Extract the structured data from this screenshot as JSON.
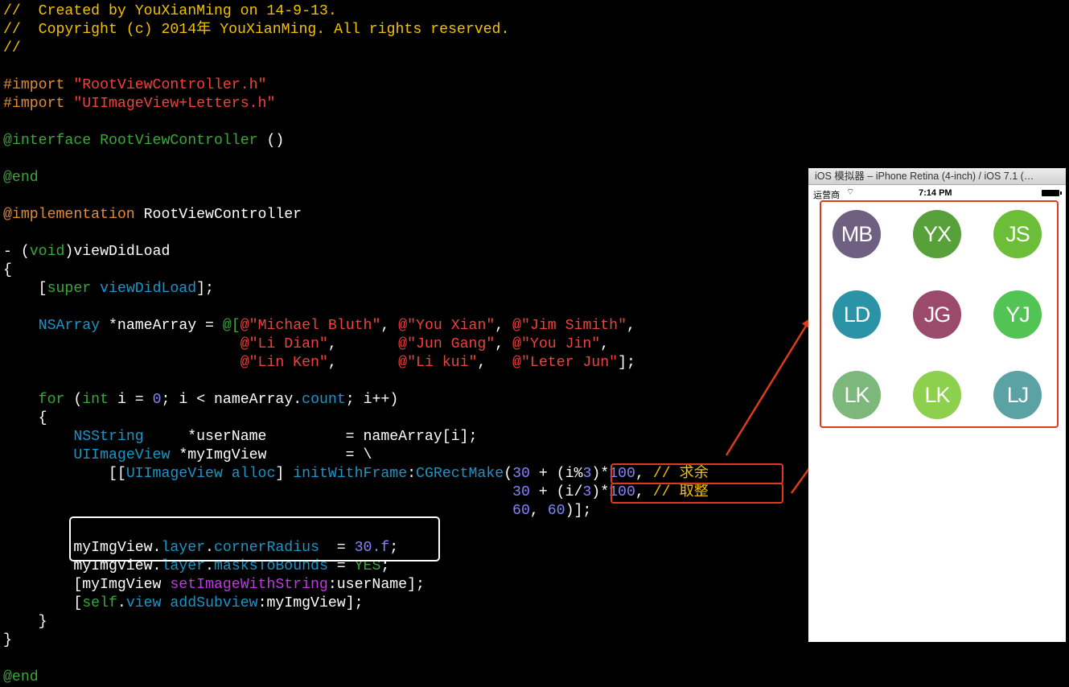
{
  "code_lines": [
    [
      [
        "//  Created by YouXianMing on 14-9-13.",
        "comment"
      ]
    ],
    [
      [
        "//  Copyright (c) 2014年 YouXianMing. All rights reserved.",
        "comment"
      ]
    ],
    [
      [
        "//",
        "comment"
      ]
    ],
    [],
    [
      [
        "#import ",
        "pre"
      ],
      [
        "\"RootViewController.h\"",
        "str"
      ]
    ],
    [
      [
        "#import ",
        "pre"
      ],
      [
        "\"UIImageView+Letters.h\"",
        "str"
      ]
    ],
    [],
    [
      [
        "@interface ",
        "kw"
      ],
      [
        "RootViewController ",
        "kw"
      ],
      [
        "()",
        "plain"
      ]
    ],
    [],
    [
      [
        "@end",
        "kw"
      ]
    ],
    [],
    [
      [
        "@implementation ",
        "pre"
      ],
      [
        "RootViewController",
        "plain"
      ]
    ],
    [],
    [
      [
        "- (",
        "plain"
      ],
      [
        "void",
        "kw"
      ],
      [
        ")viewDidLoad",
        "plain"
      ]
    ],
    [
      [
        "{",
        "plain"
      ]
    ],
    [
      [
        "    [",
        "plain"
      ],
      [
        "super ",
        "kw"
      ],
      [
        "viewDidLoad",
        "type"
      ],
      [
        "];",
        "plain"
      ]
    ],
    [],
    [
      [
        "    ",
        "plain"
      ],
      [
        "NSArray ",
        "type"
      ],
      [
        "*nameArray = ",
        "plain"
      ],
      [
        "@[",
        "kw"
      ],
      [
        "@\"Michael Bluth\"",
        "str"
      ],
      [
        ", ",
        "plain"
      ],
      [
        "@\"You Xian\"",
        "str"
      ],
      [
        ", ",
        "plain"
      ],
      [
        "@\"Jim Simith\"",
        "str"
      ],
      [
        ",",
        "plain"
      ]
    ],
    [
      [
        "                           ",
        "plain"
      ],
      [
        "@\"Li Dian\"",
        "str"
      ],
      [
        ",       ",
        "plain"
      ],
      [
        "@\"Jun Gang\"",
        "str"
      ],
      [
        ", ",
        "plain"
      ],
      [
        "@\"You Jin\"",
        "str"
      ],
      [
        ",",
        "plain"
      ]
    ],
    [
      [
        "                           ",
        "plain"
      ],
      [
        "@\"Lin Ken\"",
        "str"
      ],
      [
        ",       ",
        "plain"
      ],
      [
        "@\"Li kui\"",
        "str"
      ],
      [
        ",   ",
        "plain"
      ],
      [
        "@\"Leter Jun\"",
        "str"
      ],
      [
        "];",
        "plain"
      ]
    ],
    [],
    [
      [
        "    ",
        "plain"
      ],
      [
        "for ",
        "kw"
      ],
      [
        "(",
        "plain"
      ],
      [
        "int ",
        "kw"
      ],
      [
        "i = ",
        "plain"
      ],
      [
        "0",
        "num"
      ],
      [
        "; i < nameArray.",
        "plain"
      ],
      [
        "count",
        "type"
      ],
      [
        "; i++)",
        "plain"
      ]
    ],
    [
      [
        "    {",
        "plain"
      ]
    ],
    [
      [
        "        ",
        "plain"
      ],
      [
        "NSString     ",
        "type"
      ],
      [
        "*userName         = nameArray[i];",
        "plain"
      ]
    ],
    [
      [
        "        ",
        "plain"
      ],
      [
        "UIImageView ",
        "type"
      ],
      [
        "*myImgView         = \\",
        "plain"
      ]
    ],
    [
      [
        "            [[",
        "plain"
      ],
      [
        "UIImageView ",
        "type"
      ],
      [
        "alloc",
        "type"
      ],
      [
        "] ",
        "plain"
      ],
      [
        "initWithFrame",
        "type"
      ],
      [
        ":",
        "plain"
      ],
      [
        "CGRectMake",
        "type"
      ],
      [
        "(",
        "plain"
      ],
      [
        "30",
        "num"
      ],
      [
        " + (i%",
        "plain"
      ],
      [
        "3",
        "num"
      ],
      [
        ")*",
        "plain"
      ],
      [
        "100",
        "num"
      ],
      [
        ", ",
        "plain"
      ],
      [
        "// 求余",
        "comment"
      ]
    ],
    [
      [
        "                                                          ",
        "plain"
      ],
      [
        "30",
        "num"
      ],
      [
        " + (i/",
        "plain"
      ],
      [
        "3",
        "num"
      ],
      [
        ")*",
        "plain"
      ],
      [
        "100",
        "num"
      ],
      [
        ", ",
        "plain"
      ],
      [
        "// 取整",
        "comment"
      ]
    ],
    [
      [
        "                                                          ",
        "plain"
      ],
      [
        "60",
        "num"
      ],
      [
        ", ",
        "plain"
      ],
      [
        "60",
        "num"
      ],
      [
        ")];",
        "plain"
      ]
    ],
    [],
    [
      [
        "        myImgView.",
        "plain"
      ],
      [
        "layer",
        "type"
      ],
      [
        ".",
        "plain"
      ],
      [
        "cornerRadius",
        "type"
      ],
      [
        "  = ",
        "plain"
      ],
      [
        "30.f",
        "num"
      ],
      [
        ";",
        "plain"
      ]
    ],
    [
      [
        "        myImgView.",
        "plain"
      ],
      [
        "layer",
        "type"
      ],
      [
        ".",
        "plain"
      ],
      [
        "masksToBounds",
        "type"
      ],
      [
        " = ",
        "plain"
      ],
      [
        "YES",
        "kw"
      ],
      [
        ";",
        "plain"
      ]
    ],
    [
      [
        "        [myImgView ",
        "plain"
      ],
      [
        "setImageWithString",
        "method"
      ],
      [
        ":userName];",
        "plain"
      ]
    ],
    [
      [
        "        [",
        "plain"
      ],
      [
        "self",
        "kw"
      ],
      [
        ".",
        "plain"
      ],
      [
        "view ",
        "type"
      ],
      [
        "addSubview",
        "type"
      ],
      [
        ":myImgView];",
        "plain"
      ]
    ],
    [
      [
        "    }",
        "plain"
      ]
    ],
    [
      [
        "}",
        "plain"
      ]
    ],
    [],
    [
      [
        "@end",
        "kw"
      ]
    ]
  ],
  "simulator": {
    "title": "iOS 模拟器 – iPhone Retina (4-inch) / iOS 7.1 (…",
    "carrier": "运营商",
    "wifi": "⌔",
    "time": "7:14 PM",
    "avatars": [
      {
        "initials": "MB",
        "color": "#6f5f80"
      },
      {
        "initials": "YX",
        "color": "#57a03a"
      },
      {
        "initials": "JS",
        "color": "#6cbd38"
      },
      {
        "initials": "LD",
        "color": "#2a93a6"
      },
      {
        "initials": "JG",
        "color": "#9c4a6c"
      },
      {
        "initials": "YJ",
        "color": "#52c454"
      },
      {
        "initials": "LK",
        "color": "#7cb77c"
      },
      {
        "initials": "LK",
        "color": "#8cd04e"
      },
      {
        "initials": "LJ",
        "color": "#5aa2a4"
      }
    ]
  }
}
